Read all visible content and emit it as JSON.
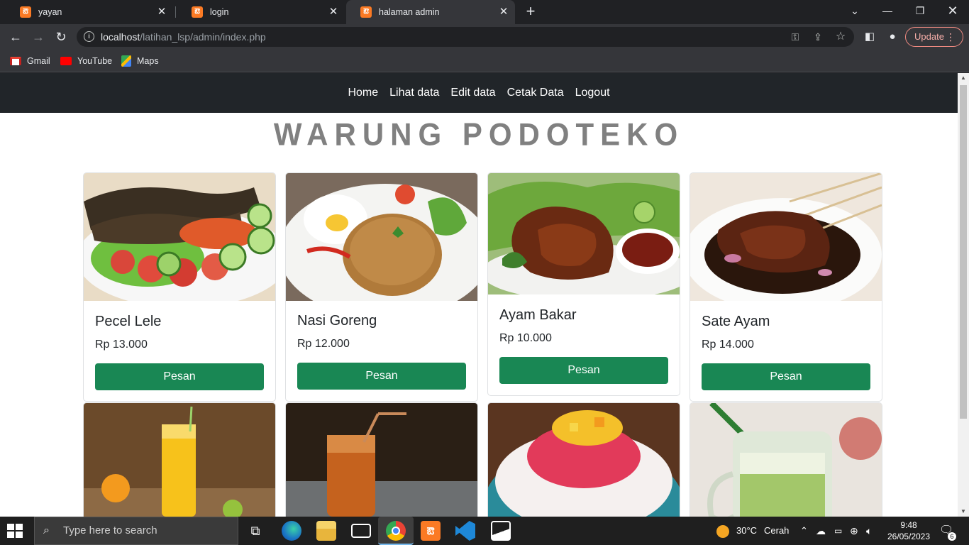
{
  "browser": {
    "tabs": [
      {
        "title": "yayan",
        "active": false
      },
      {
        "title": "login",
        "active": false
      },
      {
        "title": "halaman admin",
        "active": true
      }
    ],
    "url": {
      "host": "localhost",
      "path": "/latihan_lsp/admin/index.php"
    },
    "update_label": "Update",
    "bookmarks": [
      {
        "label": "Gmail",
        "icon": "gmail-icon"
      },
      {
        "label": "YouTube",
        "icon": "youtube-icon"
      },
      {
        "label": "Maps",
        "icon": "maps-icon"
      }
    ]
  },
  "site": {
    "nav": [
      "Home",
      "Lihat data",
      "Edit data",
      "Cetak Data",
      "Logout"
    ],
    "brand": "WARUNG PODOTEKO",
    "menu": [
      {
        "name": "Pecel Lele",
        "price": "Rp 13.000",
        "button": "Pesan"
      },
      {
        "name": "Nasi Goreng",
        "price": "Rp 12.000",
        "button": "Pesan"
      },
      {
        "name": "Ayam Bakar",
        "price": "Rp 10.000",
        "button": "Pesan"
      },
      {
        "name": "Sate Ayam",
        "price": "Rp 14.000",
        "button": "Pesan"
      }
    ],
    "drinks": [
      "orange-juice-photo",
      "iced-tea-photo",
      "es-campur-photo",
      "es-cendol-photo"
    ]
  },
  "taskbar": {
    "search_placeholder": "Type here to search",
    "weather": {
      "temp": "30°C",
      "desc": "Cerah"
    },
    "time": "9:48",
    "date": "26/05/2023",
    "notifications": "6"
  },
  "colors": {
    "accent_button": "#198754",
    "navbar": "#212529",
    "brand_text": "#808080"
  }
}
